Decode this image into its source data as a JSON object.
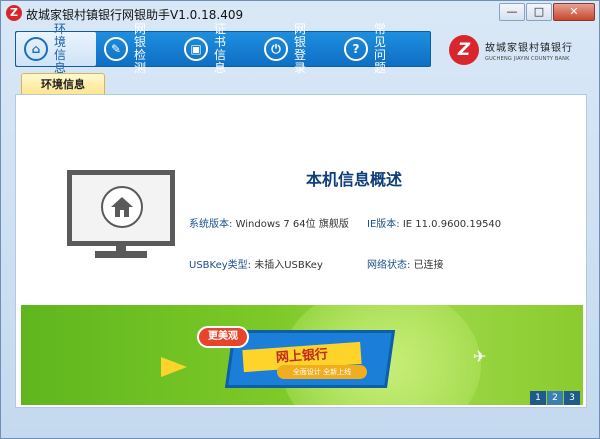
{
  "window": {
    "title": "故城家银村镇银行网银助手V1.0.18.409",
    "app_icon": "Z",
    "buttons": {
      "minimize": "—",
      "maximize": "□",
      "close": "✕"
    }
  },
  "nav": {
    "items": [
      {
        "label": "环境信息",
        "icon": "home-icon",
        "active": true
      },
      {
        "label": "网银检测",
        "icon": "repair-icon",
        "active": false
      },
      {
        "label": "证书信息",
        "icon": "certificate-icon",
        "active": false
      },
      {
        "label": "网银登录",
        "icon": "login-icon",
        "active": false
      },
      {
        "label": "常见问题",
        "icon": "help-icon",
        "active": false
      }
    ],
    "glyphs": [
      "⌂",
      "✎",
      "▣",
      "⏻",
      "?"
    ]
  },
  "bank": {
    "mark": "Z",
    "name_cn": "故城家银村镇银行",
    "name_en": "GUCHENG JIAYIN COUNTY BANK"
  },
  "tab": {
    "label": "环境信息"
  },
  "info": {
    "title": "本机信息概述",
    "os_label": "系统版本:",
    "os_value": "Windows 7 64位 旗舰版",
    "ie_label": "IE版本:",
    "ie_value": "IE 11.0.9600.19540",
    "usbkey_label": "USBKey类型:",
    "usbkey_value": "未插入USBKey",
    "network_label": "网络状态:",
    "network_value": "已连接"
  },
  "banner": {
    "badge": "更美观",
    "headline": "网上银行",
    "subline": "全面设计 全新上线",
    "pages": [
      "1",
      "2",
      "3"
    ],
    "active_page": 1
  },
  "colors": {
    "nav_blue": "#1f8fe0",
    "title_navy": "#0e3d7a",
    "banner_green": "#7dc928",
    "bank_red": "#d9262c"
  }
}
